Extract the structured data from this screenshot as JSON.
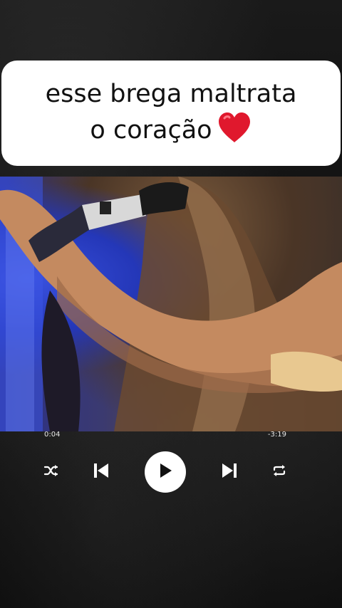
{
  "caption": {
    "line1": "esse brega maltrata",
    "line2": "o coração"
  },
  "player": {
    "elapsed": "0:04",
    "remaining": "-3:19",
    "progress_fraction": 0.02
  },
  "icons": {
    "caption_emoji": "heart-icon",
    "shuffle": "shuffle-icon",
    "previous": "skip-previous-icon",
    "play": "play-icon",
    "next": "skip-next-icon",
    "repeat": "repeat-icon"
  },
  "colors": {
    "heart": "#e0182d",
    "card": "#ffffff",
    "controls": "#ffffff"
  }
}
